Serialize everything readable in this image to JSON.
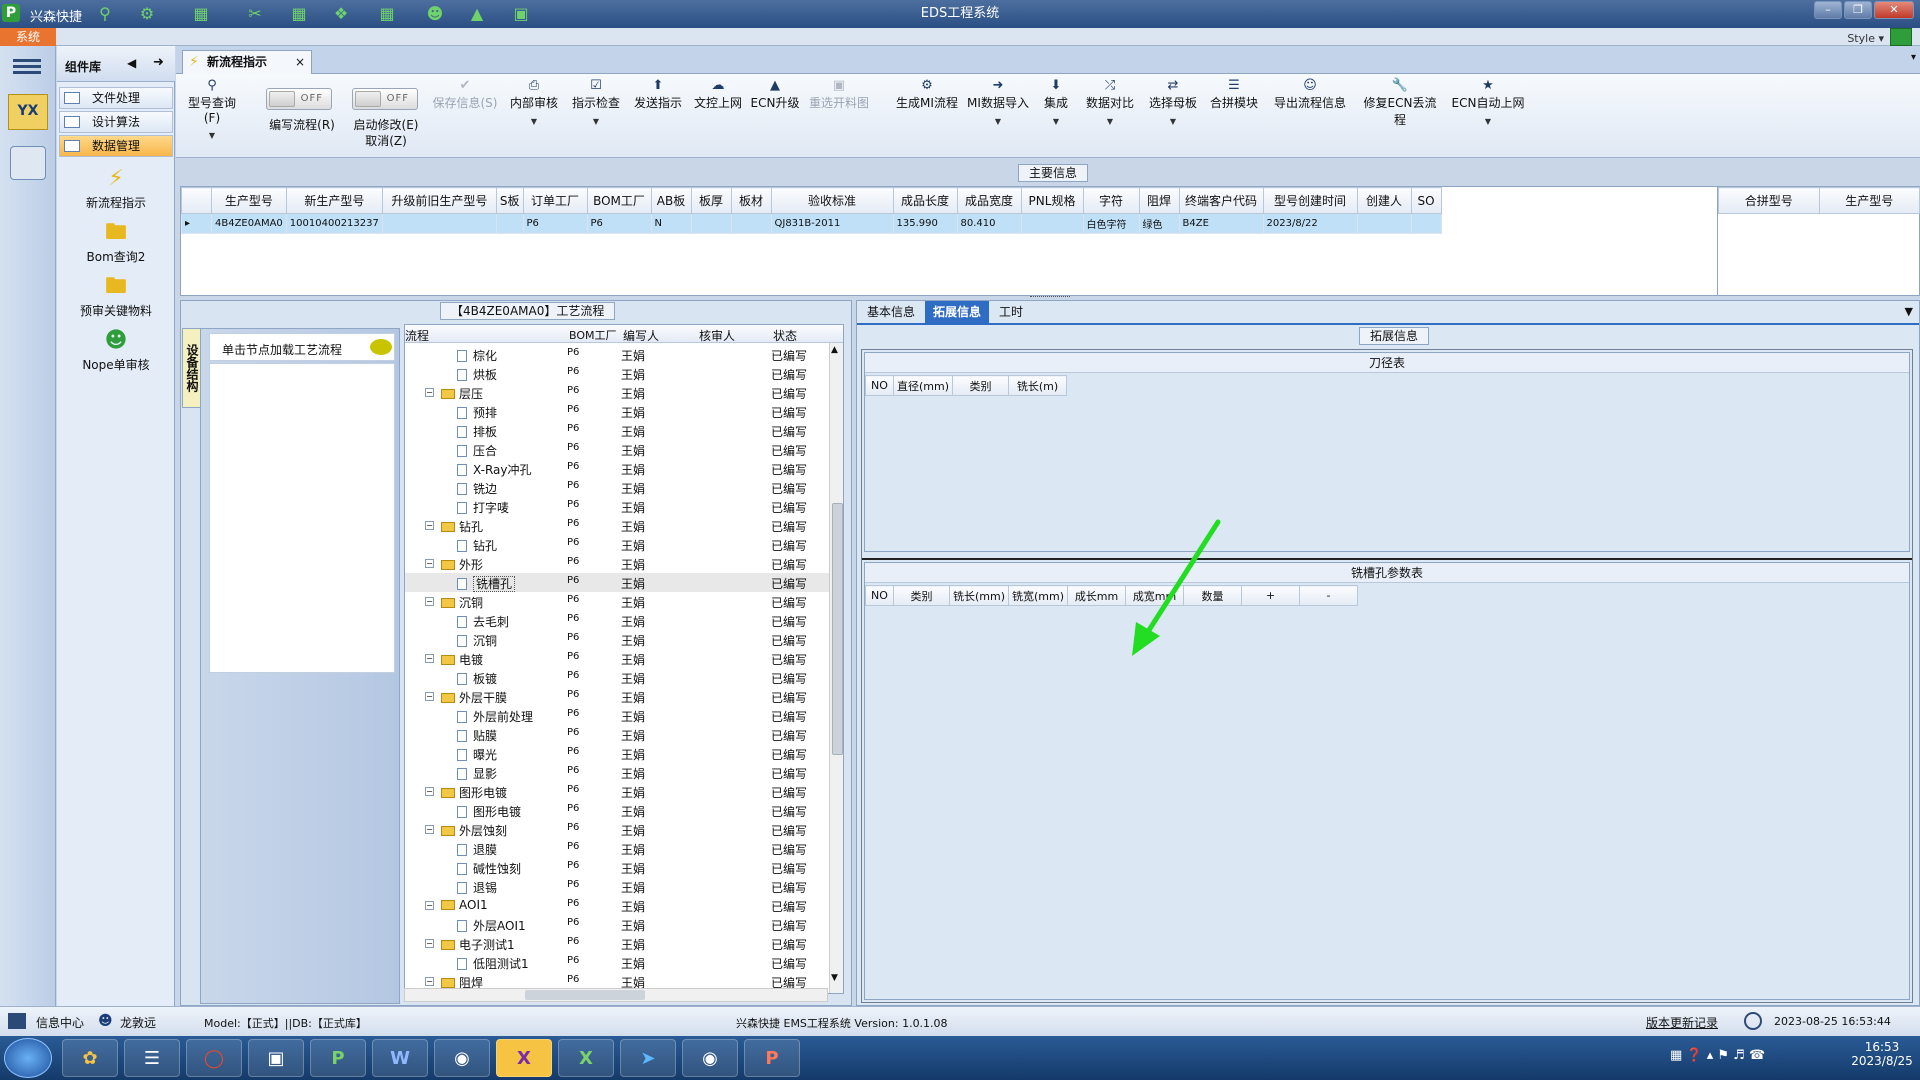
{
  "app": {
    "name": "兴森快捷",
    "window_title": "EDS工程系统",
    "style_label": "Style"
  },
  "system_tab": "系统",
  "sidebar": {
    "header": "组件库",
    "menu": [
      {
        "label": "文件处理"
      },
      {
        "label": "设计算法"
      },
      {
        "label": "数据管理"
      }
    ],
    "launchers": [
      {
        "label": "新流程指示"
      },
      {
        "label": "Bom查询2"
      },
      {
        "label": "预审关键物料"
      },
      {
        "label": "Nope单审核"
      }
    ]
  },
  "doc_tab": {
    "label": "新流程指示"
  },
  "toolbar": {
    "items": [
      {
        "label": "型号查询(F)"
      },
      {
        "label": "编写流程(R)"
      },
      {
        "label": "启动修改(E)"
      },
      {
        "label": "取消(Z)"
      },
      {
        "label": "保存信息(S)"
      },
      {
        "label": "内部审核"
      },
      {
        "label": "指示检查"
      },
      {
        "label": "发送指示"
      },
      {
        "label": "文控上网"
      },
      {
        "label": "ECN升级"
      },
      {
        "label": "重选开料图"
      },
      {
        "label": "生成MI流程"
      },
      {
        "label": "MI数据导入"
      },
      {
        "label": "集成"
      },
      {
        "label": "数据对比"
      },
      {
        "label": "选择母板"
      },
      {
        "label": "合拼模块"
      },
      {
        "label": "导出流程信息"
      },
      {
        "label": "修复ECN丢流程"
      },
      {
        "label": "ECN自动上网"
      }
    ],
    "toggle_off": "OFF"
  },
  "main_info": {
    "title": "主要信息",
    "columns": [
      "生产型号",
      "新生产型号",
      "升级前旧生产型号",
      "S板",
      "订单工厂",
      "BOM工厂",
      "AB板",
      "板厚",
      "板材",
      "验收标准",
      "成品长度",
      "成品宽度",
      "PNL规格",
      "字符",
      "阻焊",
      "终端客户代码",
      "型号创建时间",
      "创建人",
      "SO"
    ],
    "rows": [
      [
        "4B4ZE0AMA0",
        "10010400213237",
        "",
        "",
        "P6",
        "P6",
        "N",
        "",
        "",
        "QJ831B-2011",
        "135.990",
        "80.410",
        "",
        "白色字符",
        "绿色",
        "B4ZE",
        "2023/8/22",
        "",
        ""
      ]
    ],
    "side_columns": [
      "合拼型号",
      "生产型号"
    ]
  },
  "process": {
    "title": "【4B4ZE0AMA0】工艺流程",
    "vertical_tab": "设备结构",
    "hint": "单击节点加载工艺流程",
    "columns": [
      "流程",
      "BOM工厂",
      "编写人",
      "核审人",
      "状态"
    ],
    "rows": [
      {
        "name": "棕化",
        "level": 2,
        "bom": "P6",
        "writer": "王娟",
        "status": "已编写"
      },
      {
        "name": "烘板",
        "level": 2,
        "bom": "P6",
        "writer": "王娟",
        "status": "已编写"
      },
      {
        "name": "层压",
        "level": 1,
        "bom": "P6",
        "writer": "王娟",
        "status": "已编写"
      },
      {
        "name": "预排",
        "level": 2,
        "bom": "P6",
        "writer": "王娟",
        "status": "已编写"
      },
      {
        "name": "排板",
        "level": 2,
        "bom": "P6",
        "writer": "王娟",
        "status": "已编写"
      },
      {
        "name": "压合",
        "level": 2,
        "bom": "P6",
        "writer": "王娟",
        "status": "已编写"
      },
      {
        "name": "X-Ray冲孔",
        "level": 2,
        "bom": "P6",
        "writer": "王娟",
        "status": "已编写"
      },
      {
        "name": "铣边",
        "level": 2,
        "bom": "P6",
        "writer": "王娟",
        "status": "已编写"
      },
      {
        "name": "打字唛",
        "level": 2,
        "bom": "P6",
        "writer": "王娟",
        "status": "已编写"
      },
      {
        "name": "钻孔",
        "level": 1,
        "bom": "P6",
        "writer": "王娟",
        "status": "已编写"
      },
      {
        "name": "钻孔",
        "level": 2,
        "bom": "P6",
        "writer": "王娟",
        "status": "已编写"
      },
      {
        "name": "外形",
        "level": 1,
        "bom": "P6",
        "writer": "王娟",
        "status": "已编写"
      },
      {
        "name": "铣槽孔",
        "level": 2,
        "bom": "P6",
        "writer": "王娟",
        "status": "已编写",
        "selected": true
      },
      {
        "name": "沉铜",
        "level": 1,
        "bom": "P6",
        "writer": "王娟",
        "status": "已编写"
      },
      {
        "name": "去毛刺",
        "level": 2,
        "bom": "P6",
        "writer": "王娟",
        "status": "已编写"
      },
      {
        "name": "沉铜",
        "level": 2,
        "bom": "P6",
        "writer": "王娟",
        "status": "已编写"
      },
      {
        "name": "电镀",
        "level": 1,
        "bom": "P6",
        "writer": "王娟",
        "status": "已编写"
      },
      {
        "name": "板镀",
        "level": 2,
        "bom": "P6",
        "writer": "王娟",
        "status": "已编写"
      },
      {
        "name": "外层干膜",
        "level": 1,
        "bom": "P6",
        "writer": "王娟",
        "status": "已编写"
      },
      {
        "name": "外层前处理",
        "level": 2,
        "bom": "P6",
        "writer": "王娟",
        "status": "已编写"
      },
      {
        "name": "贴膜",
        "level": 2,
        "bom": "P6",
        "writer": "王娟",
        "status": "已编写"
      },
      {
        "name": "曝光",
        "level": 2,
        "bom": "P6",
        "writer": "王娟",
        "status": "已编写"
      },
      {
        "name": "显影",
        "level": 2,
        "bom": "P6",
        "writer": "王娟",
        "status": "已编写"
      },
      {
        "name": "图形电镀",
        "level": 1,
        "bom": "P6",
        "writer": "王娟",
        "status": "已编写"
      },
      {
        "name": "图形电镀",
        "level": 2,
        "bom": "P6",
        "writer": "王娟",
        "status": "已编写"
      },
      {
        "name": "外层蚀刻",
        "level": 1,
        "bom": "P6",
        "writer": "王娟",
        "status": "已编写"
      },
      {
        "name": "退膜",
        "level": 2,
        "bom": "P6",
        "writer": "王娟",
        "status": "已编写"
      },
      {
        "name": "碱性蚀刻",
        "level": 2,
        "bom": "P6",
        "writer": "王娟",
        "status": "已编写"
      },
      {
        "name": "退锡",
        "level": 2,
        "bom": "P6",
        "writer": "王娟",
        "status": "已编写"
      },
      {
        "name": "AOI1",
        "level": 1,
        "bom": "P6",
        "writer": "王娟",
        "status": "已编写"
      },
      {
        "name": "外层AOI1",
        "level": 2,
        "bom": "P6",
        "writer": "王娟",
        "status": "已编写"
      },
      {
        "name": "电子测试1",
        "level": 1,
        "bom": "P6",
        "writer": "王娟",
        "status": "已编写"
      },
      {
        "name": "低阻测试1",
        "level": 2,
        "bom": "P6",
        "writer": "王娟",
        "status": "已编写"
      },
      {
        "name": "阻焊",
        "level": 1,
        "bom": "P6",
        "writer": "王娟",
        "status": "已编写"
      }
    ]
  },
  "right": {
    "tabs": [
      {
        "label": "基本信息"
      },
      {
        "label": "拓展信息"
      },
      {
        "label": "工时"
      }
    ],
    "section_title": "拓展信息",
    "tool_table": {
      "title": "刀径表",
      "columns": [
        "NO",
        "直径(mm)",
        "类别",
        "铣长(m)"
      ]
    },
    "slot_table": {
      "title": "铣槽孔参数表",
      "columns": [
        "NO",
        "类别",
        "铣长(mm)",
        "铣宽(mm)",
        "成长mm",
        "成宽mm",
        "数量",
        "+",
        "-"
      ]
    }
  },
  "status": {
    "info_center": "信息中心",
    "user": "龙敦远",
    "model_db": "Model:【正式】||DB:【正式库】",
    "version": "兴森快捷 EMS工程系统 Version: 1.0.1.08",
    "changelog": "版本更新记录",
    "datetime": "2023-08-25 16:53:44"
  },
  "taskbar": {
    "time": "16:53",
    "date": "2023/8/25"
  },
  "colors": {
    "accent": "#2f6cc4",
    "annotation_arrow": "#22dd22",
    "selected_row": "#bfe0f7"
  }
}
